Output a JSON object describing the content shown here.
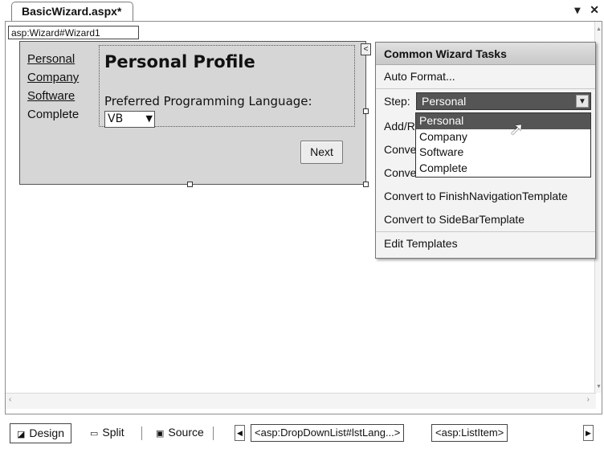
{
  "document_tab": {
    "title": "BasicWizard.aspx*",
    "pin_icon": "pin-dropdown-icon",
    "close_icon": "close-icon"
  },
  "designer": {
    "tag_chip": "asp:Wizard#Wizard1",
    "sidebar_steps": [
      "Personal",
      "Company",
      "Software",
      "Complete"
    ],
    "step_title": "Personal Profile",
    "field_label": "Preferred Programming Language:",
    "language_value": "VB",
    "next_label": "Next",
    "smart_tag_glyph": "<"
  },
  "tasks_panel": {
    "header": "Common Wizard Tasks",
    "auto_format": "Auto Format...",
    "step_label": "Step:",
    "step_value": "Personal",
    "items": [
      "Add/R",
      "Conve",
      "Conve",
      "Convert to FinishNavigationTemplate",
      "Convert to SideBarTemplate"
    ],
    "edit_templates": "Edit Templates"
  },
  "step_dropdown": {
    "options": [
      "Personal",
      "Company",
      "Software",
      "Complete"
    ],
    "selected_index": 0
  },
  "view_tabs": {
    "design": "Design",
    "split": "Split",
    "source": "Source"
  },
  "breadcrumbs": [
    "<asp:DropDownList#lstLang...>",
    "<asp:ListItem>"
  ]
}
